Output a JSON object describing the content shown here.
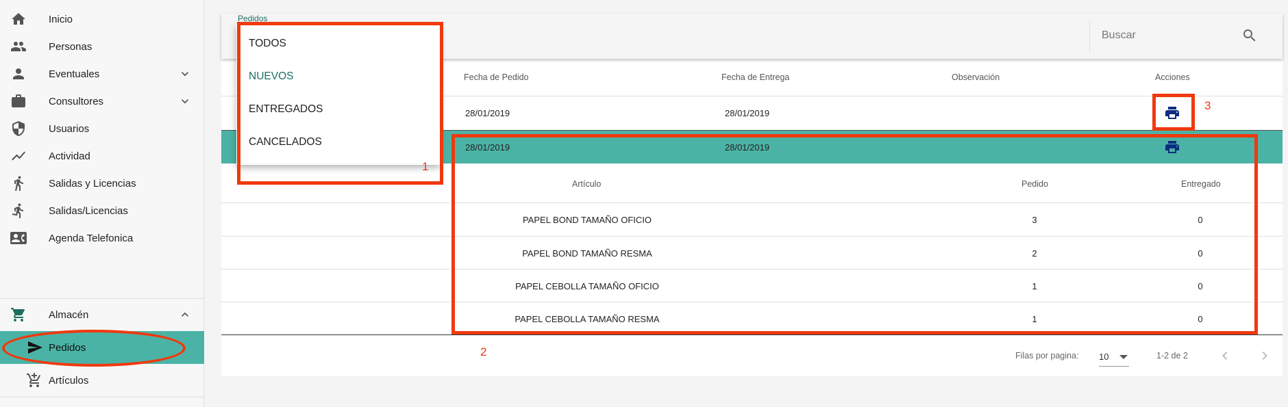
{
  "sidebar": {
    "items": [
      {
        "label": "Inicio",
        "icon": "home-icon"
      },
      {
        "label": "Personas",
        "icon": "people-icon"
      },
      {
        "label": "Eventuales",
        "icon": "person-icon",
        "chevron": "expand-more"
      },
      {
        "label": "Consultores",
        "icon": "briefcase-icon",
        "chevron": "expand-more"
      },
      {
        "label": "Usuarios",
        "icon": "shield-icon"
      },
      {
        "label": "Actividad",
        "icon": "trending-icon"
      },
      {
        "label": "Salidas y Licencias",
        "icon": "walk-icon"
      },
      {
        "label": "Salidas/Licencias",
        "icon": "run-icon"
      },
      {
        "label": "Agenda Telefonica",
        "icon": "contact-card-icon"
      },
      {
        "label": "Almacén",
        "icon": "cart-icon",
        "chevron": "expand-less"
      },
      {
        "label": "Pedidos",
        "icon": "send-icon",
        "active": true
      },
      {
        "label": "Artículos",
        "icon": "add-cart-icon"
      }
    ]
  },
  "toolbar": {
    "tab_label": "Pedidos",
    "search_placeholder": "Buscar"
  },
  "dropdown": {
    "options": [
      "TODOS",
      "NUEVOS",
      "ENTREGADOS",
      "CANCELADOS"
    ],
    "selected": "NUEVOS"
  },
  "table": {
    "headers": {
      "fecha_pedido": "Fecha de Pedido",
      "fecha_entrega": "Fecha de Entrega",
      "observacion": "Observación",
      "acciones": "Acciones"
    },
    "rows": [
      {
        "fecha_pedido": "28/01/2019",
        "fecha_entrega": "28/01/2019",
        "observacion": ""
      },
      {
        "fecha_pedido": "28/01/2019",
        "fecha_entrega": "28/01/2019",
        "observacion": "",
        "expanded": true
      }
    ]
  },
  "detail": {
    "headers": {
      "articulo": "Artículo",
      "pedido": "Pedido",
      "entregado": "Entregado"
    },
    "rows": [
      {
        "articulo": "PAPEL BOND TAMAÑO OFICIO",
        "pedido": "3",
        "entregado": "0"
      },
      {
        "articulo": "PAPEL BOND TAMAÑO RESMA",
        "pedido": "2",
        "entregado": "0"
      },
      {
        "articulo": "PAPEL CEBOLLA TAMAÑO OFICIO",
        "pedido": "1",
        "entregado": "0"
      },
      {
        "articulo": "PAPEL CEBOLLA TAMAÑO RESMA",
        "pedido": "1",
        "entregado": "0"
      }
    ]
  },
  "pagination": {
    "rows_per_page_label": "Filas por pagina:",
    "rows_per_page": "10",
    "range": "1-2 de 2"
  },
  "annotations": {
    "labels": [
      "1",
      "2",
      "3"
    ],
    "color": "#f0390f"
  },
  "colors": {
    "accent": "#4bb3a5",
    "accent_text": "#1d6e5f",
    "print_icon": "#0d2d80"
  }
}
